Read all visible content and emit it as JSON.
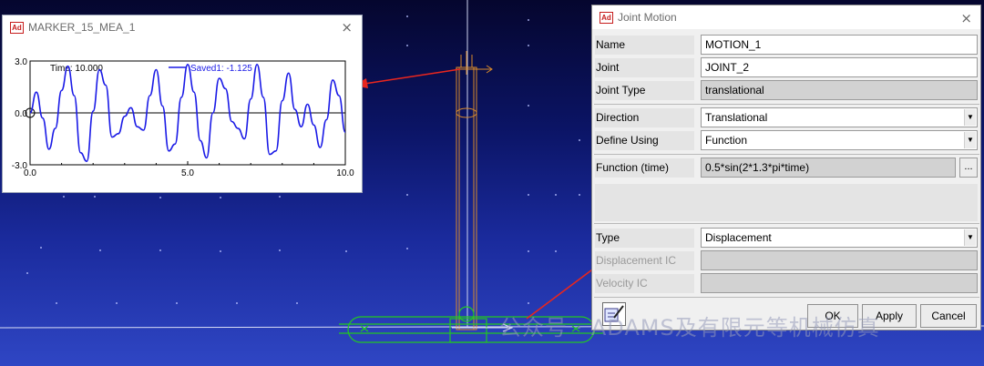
{
  "plot_window": {
    "title": "MARKER_15_MEA_1",
    "close_label": "×",
    "icon": "adams-logo-icon",
    "logo_text": "Ad"
  },
  "chart_data": {
    "type": "line",
    "title": "",
    "xlabel": "",
    "ylabel": "",
    "xlim": [
      0.0,
      10.0
    ],
    "ylim": [
      -3.0,
      3.0
    ],
    "xticks": [
      "0.0",
      "5.0",
      "10.0"
    ],
    "yticks": [
      "3.0",
      "0.0",
      "-3.0"
    ],
    "grid": false,
    "legend": "top",
    "annotations": {
      "time_label": "Time:",
      "time_value": "10.000"
    },
    "series": [
      {
        "name": "Saved1:",
        "value_label": "-1.125",
        "color": "#1a1ae6",
        "x": [
          0.0,
          0.2,
          0.4,
          0.6,
          0.8,
          1.0,
          1.2,
          1.4,
          1.6,
          1.8,
          2.0,
          2.2,
          2.4,
          2.6,
          2.8,
          3.0,
          3.2,
          3.4,
          3.6,
          3.8,
          4.0,
          4.2,
          4.4,
          4.6,
          4.8,
          5.0,
          5.2,
          5.4,
          5.6,
          5.8,
          6.0,
          6.2,
          6.4,
          6.6,
          6.8,
          7.0,
          7.2,
          7.4,
          7.6,
          7.8,
          8.0,
          8.2,
          8.4,
          8.6,
          8.8,
          9.0,
          9.2,
          9.4,
          9.6,
          9.8,
          10.0
        ],
        "y": [
          0.0,
          1.2,
          -0.3,
          -2.1,
          -0.9,
          1.3,
          2.7,
          1.0,
          -2.3,
          -2.8,
          0.1,
          2.5,
          1.6,
          -1.4,
          -1.2,
          -0.2,
          0.3,
          -0.8,
          -1.0,
          1.0,
          2.5,
          0.4,
          -2.2,
          -1.8,
          0.9,
          2.8,
          1.2,
          -1.6,
          -2.6,
          0.0,
          2.0,
          1.4,
          -0.5,
          -0.9,
          -1.5,
          0.8,
          2.8,
          0.9,
          -2.4,
          -2.2,
          0.7,
          2.3,
          0.2,
          -0.8,
          0.5,
          -0.7,
          -2.0,
          -0.4,
          1.9,
          1.0,
          -1.125
        ]
      }
    ]
  },
  "dialog": {
    "title": "Joint Motion",
    "icon": "adams-logo-icon",
    "logo_text": "Ad",
    "close_label": "×",
    "fields": {
      "name_label": "Name",
      "name_value": "MOTION_1",
      "joint_label": "Joint",
      "joint_value": "JOINT_2",
      "joint_type_label": "Joint Type",
      "joint_type_value": "translational",
      "direction_label": "Direction",
      "direction_value": "Translational",
      "define_using_label": "Define Using",
      "define_using_value": "Function",
      "function_label": "Function (time)",
      "function_value": "0.5*sin(2*1.3*pi*time)",
      "function_button": "...",
      "type_label": "Type",
      "type_value": "Displacement",
      "displacement_ic_label": "Displacement IC",
      "velocity_ic_label": "Velocity IC"
    },
    "buttons": {
      "ok": "OK",
      "apply": "Apply",
      "cancel": "Cancel"
    },
    "tool_icon": "function-builder-icon"
  },
  "watermark": "公众号 · ADAMS及有限元等机械仿真",
  "colors": {
    "background_top": "#05062e",
    "background_bottom": "#2f46c4",
    "model_green": "#22c822",
    "model_orange": "#d98a2b",
    "arrow_red": "#e8261e",
    "curve_blue": "#1a1ae6"
  }
}
